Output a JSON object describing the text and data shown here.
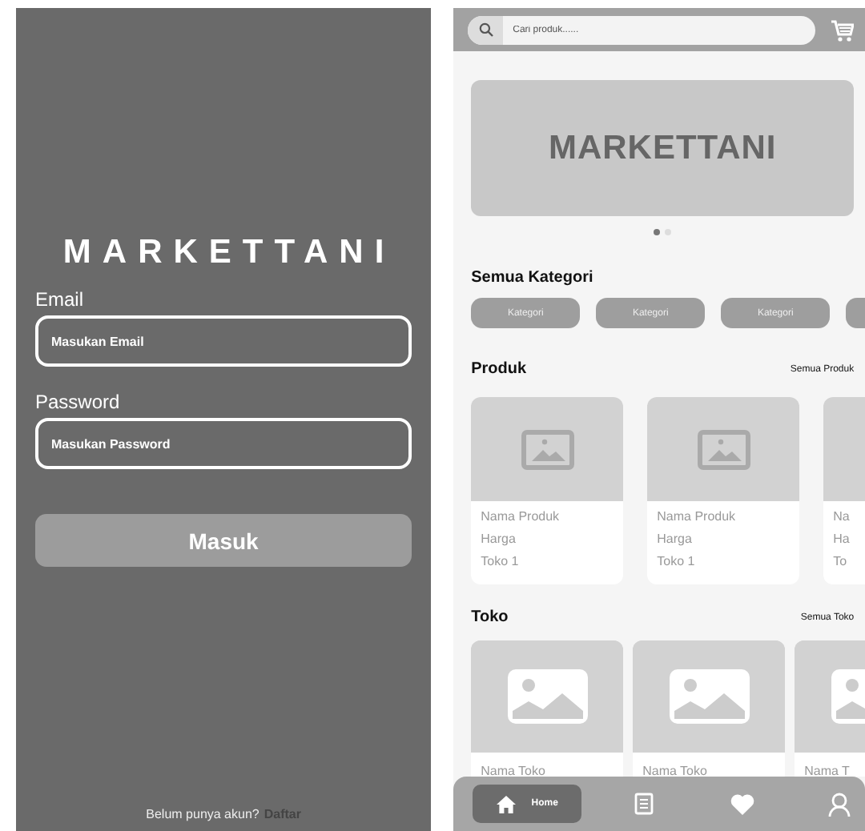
{
  "login": {
    "title": "MARKETTANI",
    "fields": [
      {
        "label": "Email",
        "placeholder": "Masukan Email"
      },
      {
        "label": "Password",
        "placeholder": "Masukan Password"
      }
    ],
    "button": "Masuk",
    "footer": {
      "text": "Belum punya akun?",
      "link": "Daftar"
    }
  },
  "home": {
    "search": {
      "placeholder": "Cari produk......"
    },
    "banner": {
      "title": "MARKETTANI"
    },
    "carousel_dots": [
      {
        "selected": true
      },
      {
        "selected": false
      }
    ],
    "categories": {
      "title": "Semua Kategori",
      "items": [
        "Kategori",
        "Kategori",
        "Kategori"
      ]
    },
    "products": {
      "title": "Produk",
      "link": "Semua Produk",
      "items": [
        {
          "name": "Nama Produk",
          "price": "Harga",
          "store": "Toko 1"
        },
        {
          "name": "Nama Produk",
          "price": "Harga",
          "store": "Toko 1"
        },
        {
          "name": "Na",
          "price": "Ha",
          "store": "To"
        }
      ]
    },
    "stores": {
      "title": "Toko",
      "link": "Semua Toko",
      "items": [
        {
          "name": "Nama Toko"
        },
        {
          "name": "Nama Toko"
        },
        {
          "name": "Nama T"
        }
      ]
    },
    "nav": [
      {
        "kind": "home",
        "label": "Home",
        "selected": true
      },
      {
        "kind": "orders",
        "selected": false
      },
      {
        "kind": "favorites",
        "selected": false
      },
      {
        "kind": "profile",
        "selected": false
      }
    ]
  }
}
